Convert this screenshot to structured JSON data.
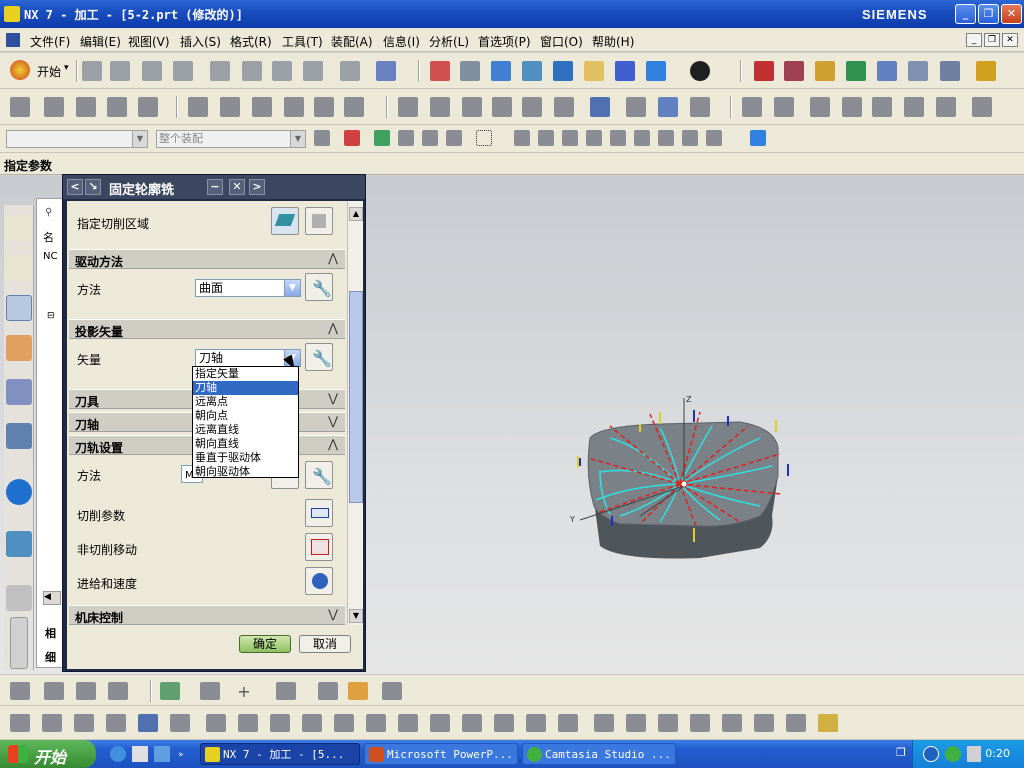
{
  "window": {
    "title": "NX 7 - 加工 - [5-2.prt (修改的)]",
    "brand": "SIEMENS",
    "min_label": "_",
    "max_label": "❐",
    "close_label": "✕"
  },
  "menubar": {
    "items": [
      "文件(F)",
      "编辑(E)",
      "视图(V)",
      "插入(S)",
      "格式(R)",
      "工具(T)",
      "装配(A)",
      "信息(I)",
      "分析(L)",
      "首选项(P)",
      "窗口(O)",
      "帮助(H)"
    ]
  },
  "toolbar": {
    "start_label": "开始",
    "start_dropdown": "▾",
    "filter_placeholder": "",
    "assembly_scope": "整个装配"
  },
  "prompt": {
    "text": "指定参数"
  },
  "dialog": {
    "title": "固定轮廓铣",
    "nav_prev": "<",
    "nav_next": ">",
    "reset": "↘",
    "minimize": "−",
    "close": "✕",
    "cut_area_label": "指定切削区域",
    "drive": {
      "header": "驱动方法",
      "method_label": "方法",
      "method_value": "曲面"
    },
    "projection": {
      "header": "投影矢量",
      "vector_label": "矢量",
      "vector_value": "刀轴",
      "options": [
        "指定矢量",
        "刀轴",
        "远离点",
        "朝向点",
        "远离直线",
        "朝向直线",
        "垂直于驱动体",
        "朝向驱动体"
      ],
      "selected_index": 1
    },
    "tool": {
      "header": "刀具"
    },
    "axis": {
      "header": "刀轴"
    },
    "path": {
      "header": "刀轨设置",
      "method_label": "方法",
      "method_value": "MI",
      "cut_params_label": "切削参数",
      "non_cut_label": "非切削移动",
      "feeds_label": "进给和速度"
    },
    "machine": {
      "header": "机床控制"
    },
    "ok_label": "确定",
    "cancel_label": "取消"
  },
  "navigator": {
    "col1": "名",
    "row1": "NC",
    "footer1": "相",
    "footer2": "细"
  },
  "taskbar": {
    "start": "开始",
    "tasks": [
      "NX 7 - 加工 - [5...",
      "Microsoft PowerP...",
      "Camtasia Studio ..."
    ],
    "clock": "0:20"
  },
  "colors": {
    "titlebar": "#1a4fc0",
    "dialog_frame": "#1f2a44",
    "selected": "#316ac5",
    "part": "#6f777e",
    "toolpath_cyan": "#30e0e0",
    "toolpath_red": "#e02020"
  }
}
